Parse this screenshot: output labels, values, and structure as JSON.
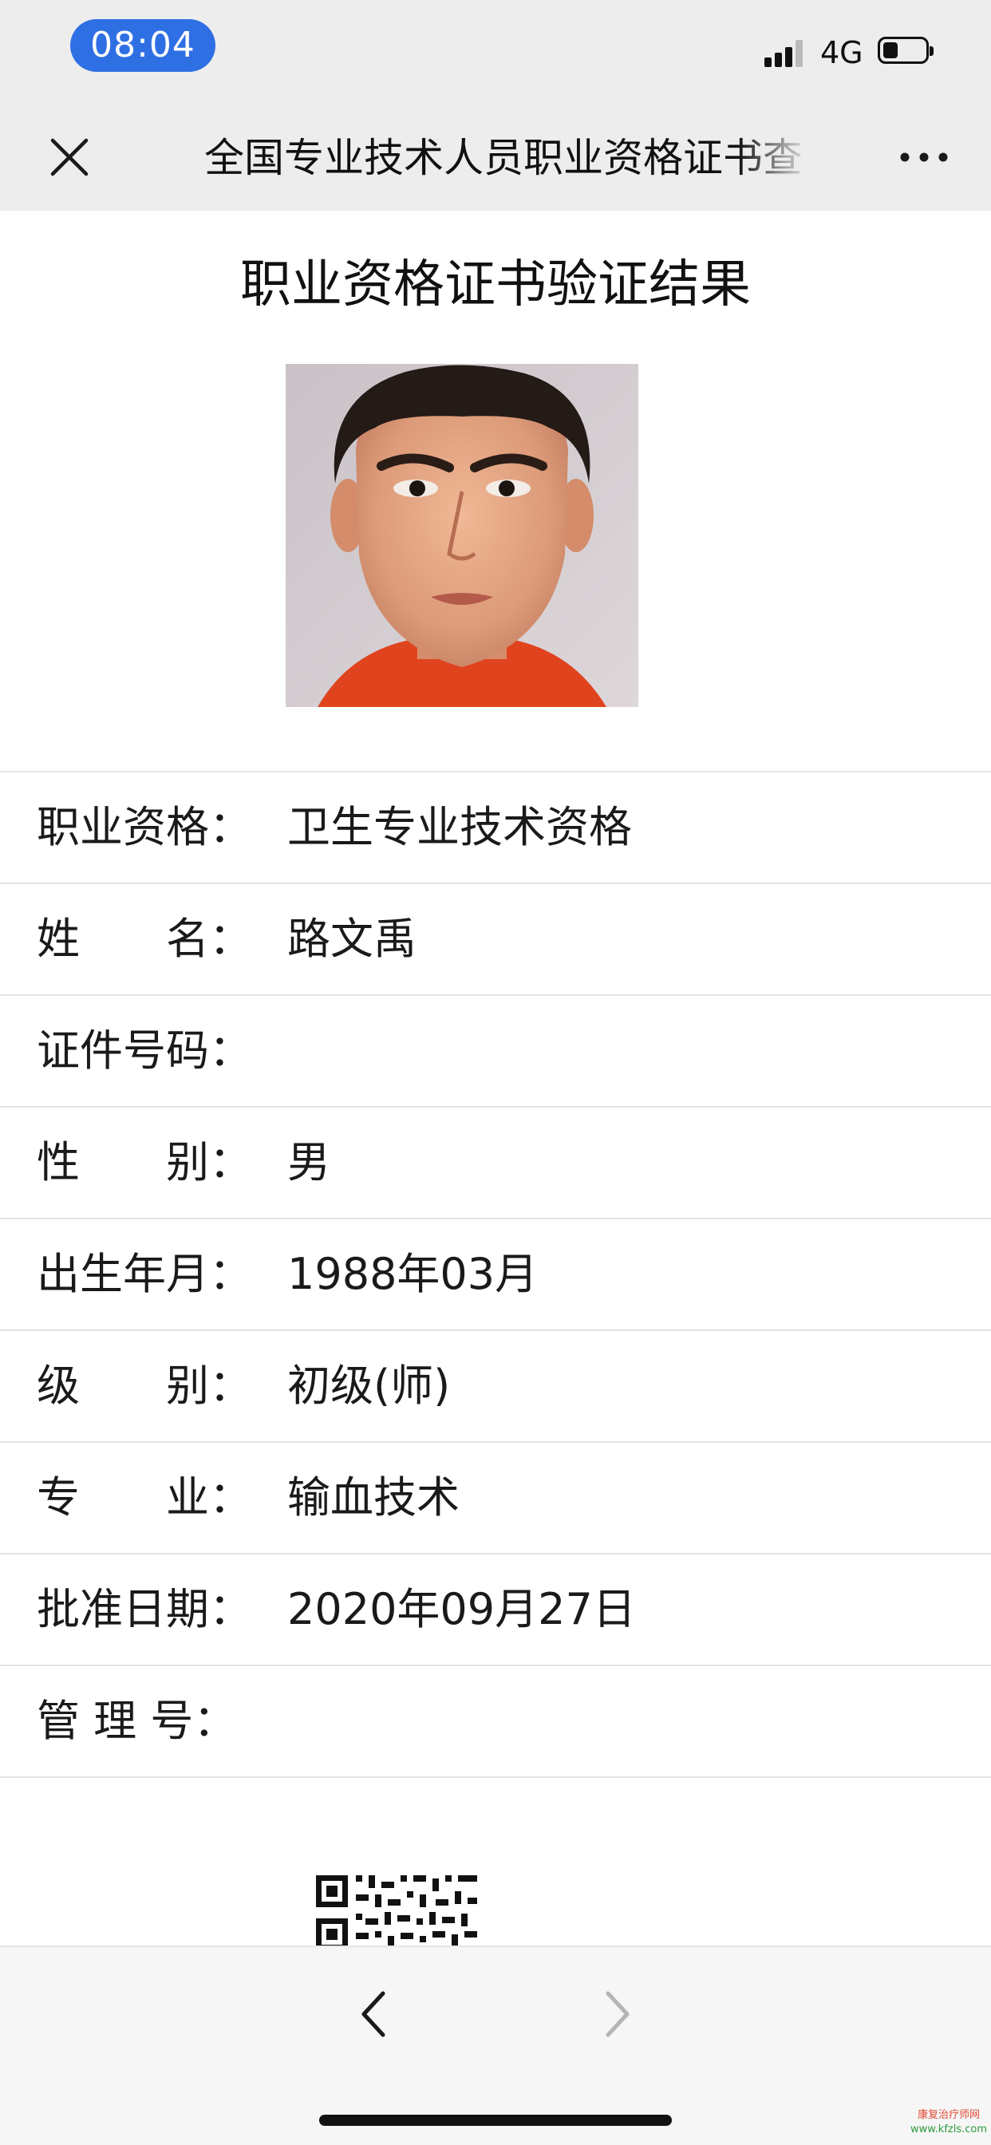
{
  "status_bar": {
    "time": "08:04",
    "network": "4G",
    "signal_icon": "signal-bars-icon",
    "battery_icon": "battery-icon",
    "battery_level": 0.35,
    "time_pill_color": "#2f6fe4"
  },
  "nav": {
    "title": "全国专业技术人员职业资格证书查",
    "close_icon": "close-icon",
    "more_icon": "more-icon"
  },
  "page": {
    "title": "职业资格证书验证结果"
  },
  "photo": {
    "icon": "id-photo"
  },
  "fields": [
    {
      "label": "职业资格：",
      "value": "卫生专业技术资格"
    },
    {
      "label": "姓　　名：",
      "value": "路文禹"
    },
    {
      "label": "证件号码：",
      "value": ""
    },
    {
      "label": "性　　别：",
      "value": "男"
    },
    {
      "label": "出生年月：",
      "value": "1988年03月"
    },
    {
      "label": "级　　别：",
      "value": "初级(师)"
    },
    {
      "label": "专　　业：",
      "value": "输血技术"
    },
    {
      "label": "批准日期：",
      "value": "2020年09月27日"
    },
    {
      "label": "管 理 号：",
      "value": ""
    }
  ],
  "qr": {
    "icon": "qr-code"
  },
  "toolbar": {
    "back_icon": "chevron-left-icon",
    "forward_icon": "chevron-right-icon"
  },
  "watermark": {
    "name": "康复治疗师网",
    "url": "www.kfzls.com"
  },
  "colors": {
    "bar_background": "#ededed",
    "divider": "#e3e3e3",
    "text": "#1a1a1a"
  }
}
